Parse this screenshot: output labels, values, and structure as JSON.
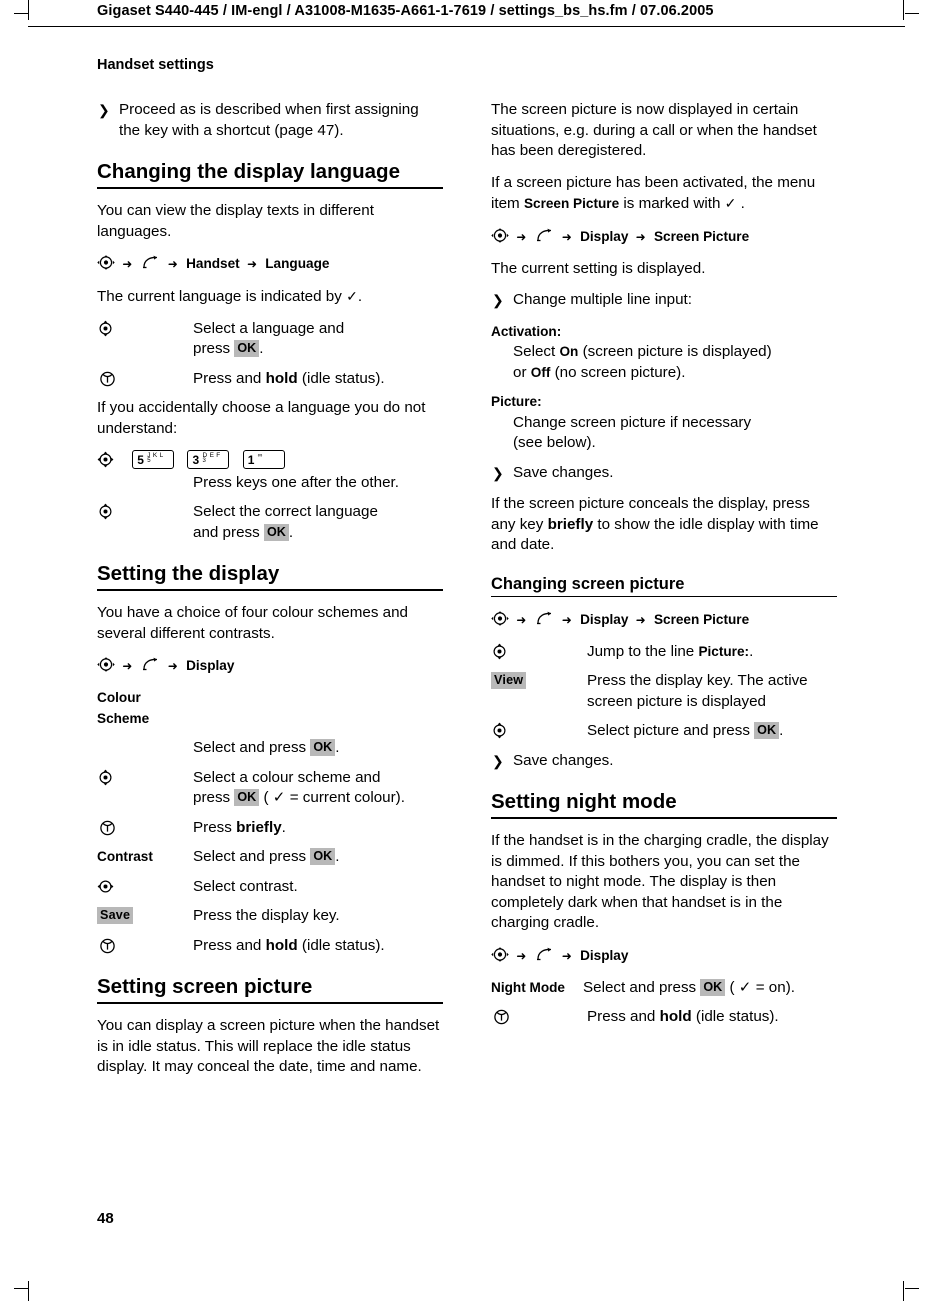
{
  "header": {
    "file_line": "Gigaset S440-445 / IM-engl / A31008-M1635-A661-1-7619 / settings_bs_hs.fm / 07.06.2005",
    "chapter": "Handset settings",
    "page_number": "48"
  },
  "left_column": {
    "intro_item": "Proceed as is described when first assigning the key with a shortcut (page 47).",
    "sections": {
      "language": {
        "title": "Changing the display language",
        "p1": "You can view the display texts in different languages.",
        "path": {
          "menu": "Handset",
          "item": "Language"
        },
        "p2_pre": "The current language is indicated by",
        "p2_post": ".",
        "act1_desc_line1": "Select a language and",
        "act1_desc_line2_pre": "press",
        "act1_key": "OK",
        "act1_desc_line2_post": ".",
        "act2_desc_pre": "Press and",
        "act2_desc_bold": "hold",
        "act2_desc_post": "(idle status).",
        "p3": "If you accidentally choose a language you do not understand:",
        "keys": [
          {
            "digit": "5",
            "sub": "J K L",
            "sub2": "5"
          },
          {
            "digit": "3",
            "sub": "D E F",
            "sub2": "3"
          },
          {
            "digit": "1",
            "sub": "∞",
            "sub2": ""
          }
        ],
        "keys_desc": "Press keys one after the other.",
        "act3_desc_line1": "Select the correct language",
        "act3_desc_line2_pre": "and press",
        "act3_key": "OK",
        "act3_desc_line2_post": "."
      },
      "display": {
        "title": "Setting the display",
        "p1": "You have a choice of four colour schemes and several different contrasts.",
        "path": {
          "item": "Display"
        },
        "colour_scheme_label": "Colour Scheme",
        "colour_scheme_desc_pre": "Select and press",
        "colour_scheme_key": "OK",
        "colour_scheme_desc_post": ".",
        "act1_line1": "Select a colour scheme and",
        "act1_line2_pre": "press",
        "act1_key": "OK",
        "act1_line2_post": "( ✓ = current colour).",
        "act2_pre": "Press",
        "act2_bold": "briefly",
        "act2_post": ".",
        "contrast_label": "Contrast",
        "contrast_desc_pre": "Select and press",
        "contrast_key": "OK",
        "contrast_desc_post": ".",
        "act3_desc": "Select contrast.",
        "save_key": "Save",
        "save_desc": "Press the display key.",
        "act4_pre": "Press and",
        "act4_bold": "hold",
        "act4_post": "(idle status)."
      },
      "screen_picture": {
        "title": "Setting screen picture",
        "p1": "You can display a screen picture when the handset is in idle status. This will replace the idle status display. It may conceal the date, time and name."
      }
    }
  },
  "right_column": {
    "p1": "The screen picture is now displayed in certain situations, e.g. during a call or when the handset has been deregistered.",
    "p2_pre": "If a screen picture has been activated, the menu item",
    "p2_menu": "Screen Picture",
    "p2_mid": "is marked with",
    "p2_post": ".",
    "path1": {
      "menu": "Display",
      "item": "Screen Picture"
    },
    "p3": "The current setting is displayed.",
    "item1": "Change multiple line input:",
    "activation_label": "Activation:",
    "activation_line1_pre": "Select",
    "activation_on": "On",
    "activation_line1_post": "(screen picture is displayed)",
    "activation_line2_pre": "or",
    "activation_off": "Off",
    "activation_line2_post": "(no screen picture).",
    "picture_label": "Picture:",
    "picture_line1": "Change screen picture if necessary",
    "picture_line2": "(see below).",
    "item2": "Save changes.",
    "p4_pre": "If the screen picture conceals the display, press any key",
    "p4_bold": "briefly",
    "p4_post": "to show the idle display with time and date.",
    "sections": {
      "changing_screen_picture": {
        "title": "Changing screen picture",
        "path": {
          "menu": "Display",
          "item": "Screen Picture"
        },
        "act1_desc_pre": "Jump to the line",
        "act1_desc_bold": "Picture:",
        "act1_desc_post": ".",
        "view_key": "View",
        "view_desc": "Press the display key. The active screen picture is displayed",
        "act2_pre": "Select picture and press",
        "act2_key": "OK",
        "act2_post": ".",
        "item1": "Save changes."
      },
      "night_mode": {
        "title": "Setting night mode",
        "p1": "If the handset is in the charging cradle, the display is dimmed. If this bothers you, you can set the handset to night mode. The display is then completely dark when that handset is in the charging cradle.",
        "path": {
          "item": "Display"
        },
        "night_mode_label": "Night Mode",
        "night_mode_desc_pre": "Select and press",
        "night_mode_key": "OK",
        "night_mode_desc_post": "( ✓ = on).",
        "act1_pre": "Press and",
        "act1_bold": "hold",
        "act1_post": "(idle status)."
      }
    }
  },
  "icons": {
    "nav_control": "navigation-key-icon",
    "menu": "menu-key-icon",
    "end_call": "end-call-key-icon",
    "arrow_right": "➜",
    "list_arrow": "❯",
    "tick": "✓"
  }
}
